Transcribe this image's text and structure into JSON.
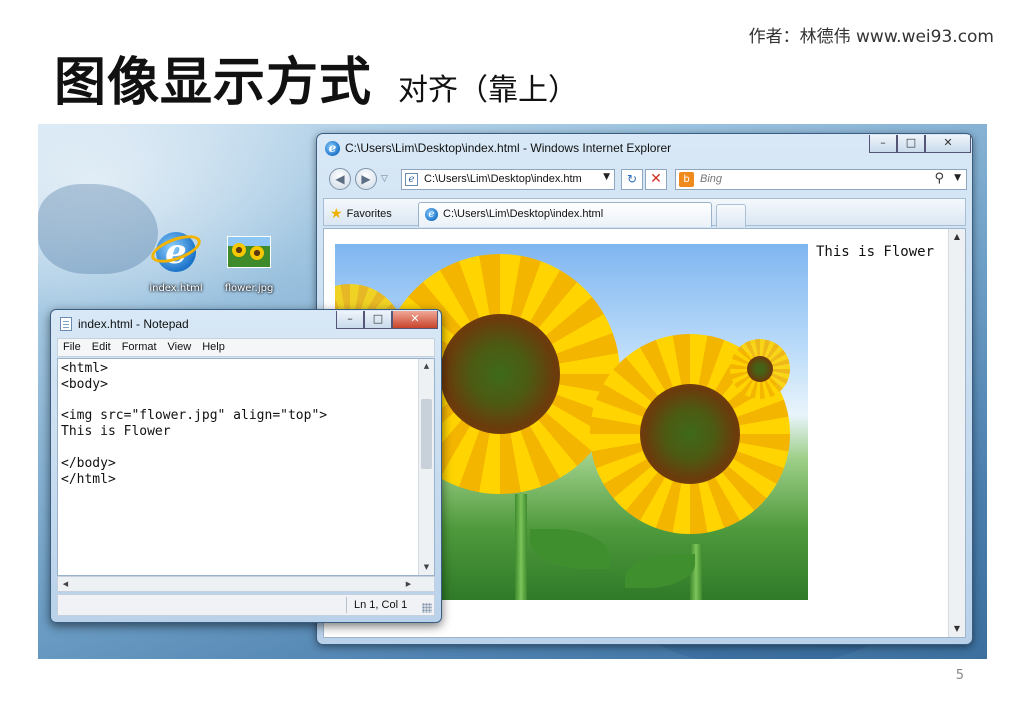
{
  "slide": {
    "author": "作者：林德伟 www.wei93.com",
    "title": "图像显示方式",
    "subtitle": "对齐（靠上）",
    "page_number": "5"
  },
  "desktop": {
    "icons": [
      {
        "label": "index.html",
        "icon": "ie-file-icon"
      },
      {
        "label": "flower.jpg",
        "icon": "image-file-icon"
      }
    ]
  },
  "browser": {
    "title": "C:\\Users\\Lim\\Desktop\\index.html - Windows Internet Explorer",
    "address": "C:\\Users\\Lim\\Desktop\\index.htm",
    "search_placeholder": "Bing",
    "favorites_label": "Favorites",
    "tab_label": "C:\\Users\\Lim\\Desktop\\index.html",
    "page_text": "This is Flower",
    "caption_buttons": {
      "minimize": "–",
      "maximize": "□",
      "close": "✕"
    }
  },
  "notepad": {
    "title": "index.html - Notepad",
    "menu": [
      "File",
      "Edit",
      "Format",
      "View",
      "Help"
    ],
    "text": "<html>\n<body>\n\n<img src=\"flower.jpg\" align=\"top\">\nThis is Flower\n\n</body>\n</html>",
    "status": "Ln 1, Col 1",
    "caption_buttons": {
      "minimize": "–",
      "maximize": "□",
      "close": "✕"
    }
  },
  "colors": {
    "close_button": "#c8442c",
    "desktop_blue": "#4c7fae",
    "ie_blue": "#1b73c9",
    "bing_orange": "#f08a1c"
  }
}
